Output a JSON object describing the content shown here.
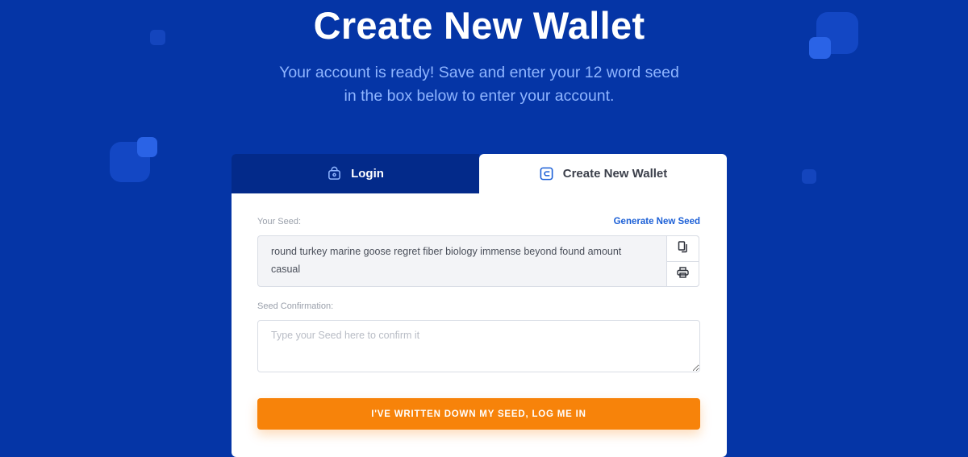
{
  "hero": {
    "title": "Create New Wallet",
    "subtitle_line1": "Your account is ready! Save and enter your 12 word seed",
    "subtitle_line2": "in the box below to enter your account."
  },
  "tabs": [
    {
      "label": "Login",
      "icon": "lock-icon",
      "active": false
    },
    {
      "label": "Create New Wallet",
      "icon": "wallet-icon",
      "active": true
    }
  ],
  "form": {
    "seed_label": "Your Seed:",
    "generate_link": "Generate New Seed",
    "seed_value": "round turkey marine goose regret fiber biology immense beyond found amount casual",
    "copy_icon": "copy-icon",
    "print_icon": "printer-icon",
    "confirm_label": "Seed Confirmation:",
    "confirm_placeholder": "Type your Seed here to confirm it",
    "confirm_value": "",
    "submit_label": "I'VE WRITTEN DOWN MY SEED, LOG ME IN"
  },
  "colors": {
    "background": "#0535a6",
    "login_tab": "#032a8a",
    "accent_link": "#1b5fd6",
    "submit_button": "#f7830a",
    "subtitle": "#8fb5ff"
  }
}
